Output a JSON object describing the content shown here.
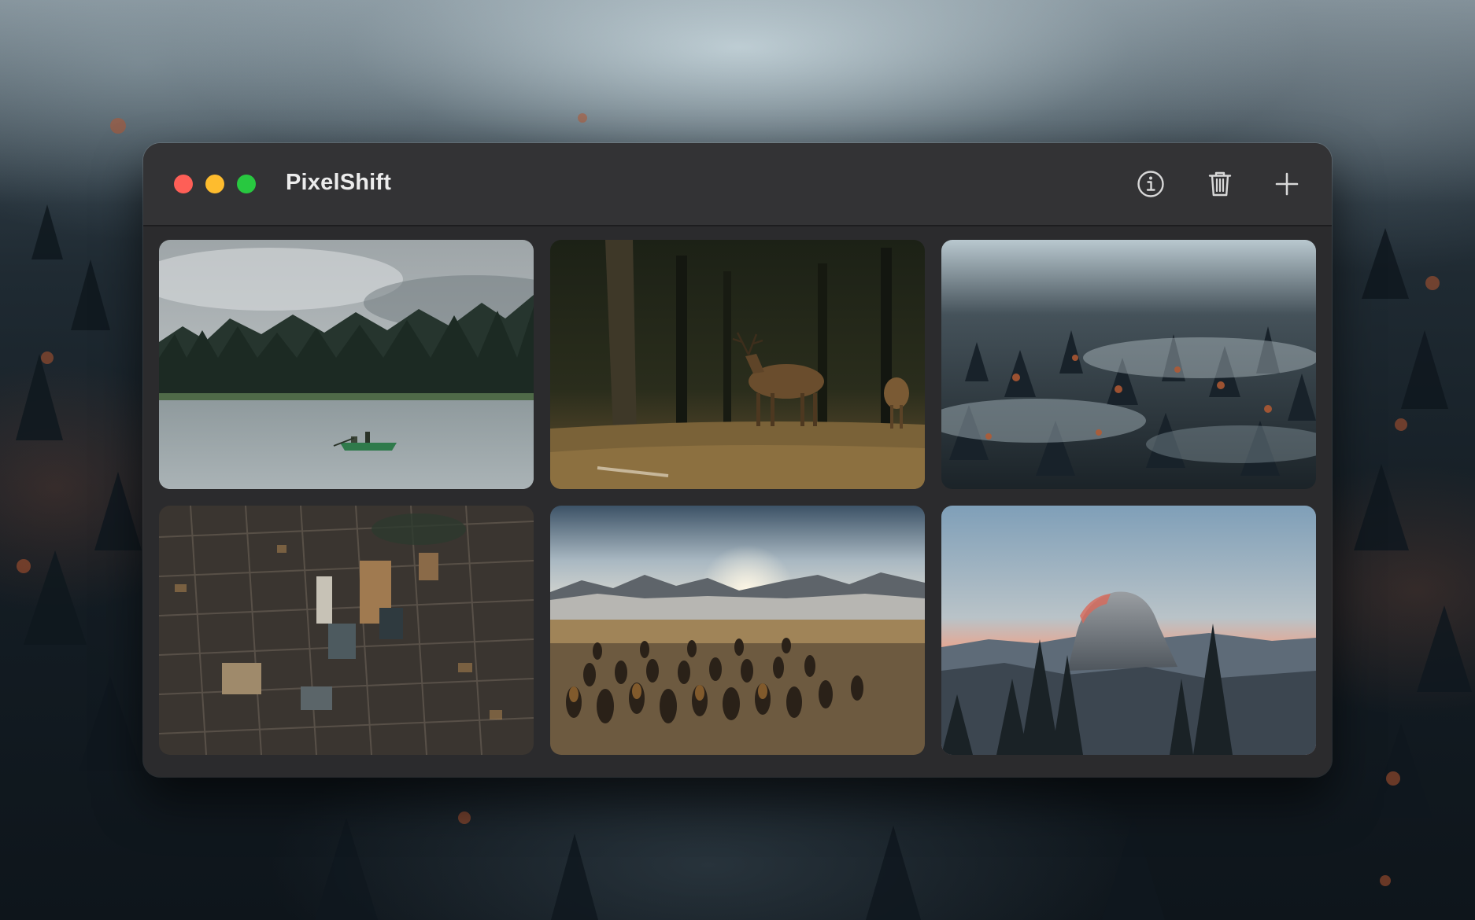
{
  "window": {
    "title": "PixelShift",
    "traffic_lights": {
      "close_color": "#fe5f57",
      "minimize_color": "#febc2e",
      "maximize_color": "#28c840"
    }
  },
  "toolbar": {
    "icons": [
      "info-icon",
      "trash-icon",
      "plus-icon"
    ]
  },
  "gallery": {
    "photos": [
      {
        "scene": "lake-canoe"
      },
      {
        "scene": "forest-deer"
      },
      {
        "scene": "misty-forest"
      },
      {
        "scene": "city-aerial"
      },
      {
        "scene": "penguin-colony"
      },
      {
        "scene": "half-dome-sunset"
      }
    ]
  },
  "colors": {
    "window_bg": "#2b2b2d",
    "titlebar_bg": "#333335",
    "title_text": "#ececec",
    "icon_color": "#d8d8d8"
  }
}
